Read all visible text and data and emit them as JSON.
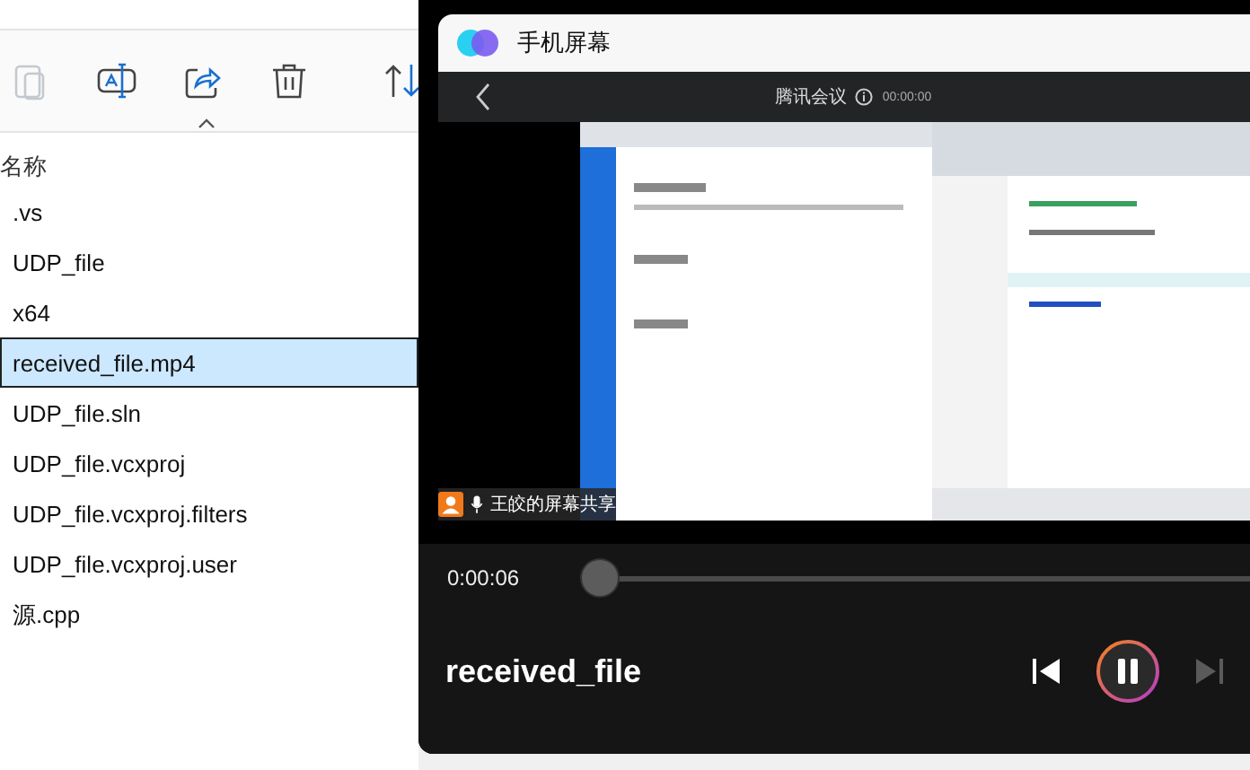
{
  "explorer": {
    "toolbar": [
      {
        "kind": "paste",
        "disabled": true
      },
      {
        "kind": "rename",
        "disabled": false
      },
      {
        "kind": "share",
        "disabled": false
      },
      {
        "kind": "delete",
        "disabled": false
      },
      {
        "kind": "sort",
        "disabled": false
      }
    ],
    "column_header": "名称",
    "files": [
      {
        "name": ".vs",
        "selected": false
      },
      {
        "name": "UDP_file",
        "selected": false
      },
      {
        "name": "x64",
        "selected": false
      },
      {
        "name": "received_file.mp4",
        "selected": true
      },
      {
        "name": "UDP_file.sln",
        "selected": false
      },
      {
        "name": "UDP_file.vcxproj",
        "selected": false
      },
      {
        "name": "UDP_file.vcxproj.filters",
        "selected": false
      },
      {
        "name": "UDP_file.vcxproj.user",
        "selected": false
      },
      {
        "name": "源.cpp",
        "selected": false
      }
    ]
  },
  "player": {
    "app_title": "手机屏幕",
    "video": {
      "kind": "picture",
      "bar_title": "腾讯会议",
      "timer": "00:00:00",
      "share_label": "王皎的屏幕共享"
    },
    "elapsed": "0:00:06",
    "progress": {
      "level": 0
    },
    "title": "received_file",
    "buttons": [
      {
        "kind": "previous",
        "disabled": false
      },
      {
        "kind": "pause",
        "disabled": false
      },
      {
        "kind": "next",
        "disabled": true
      }
    ]
  }
}
